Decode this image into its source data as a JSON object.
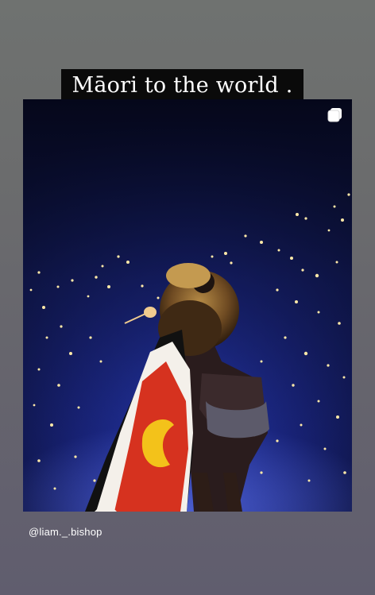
{
  "story": {
    "caption": "Māori to the world .",
    "credit_handle": "@liam._.bishop",
    "media": {
      "description_icon": "multiple-media-icon",
      "colors": {
        "stage_dark": "#0b0f2c",
        "crowd_blue": "#1b2a9a",
        "flag_red": "#d6321f",
        "flag_yellow": "#f3c21a",
        "flag_black": "#111111"
      }
    }
  }
}
